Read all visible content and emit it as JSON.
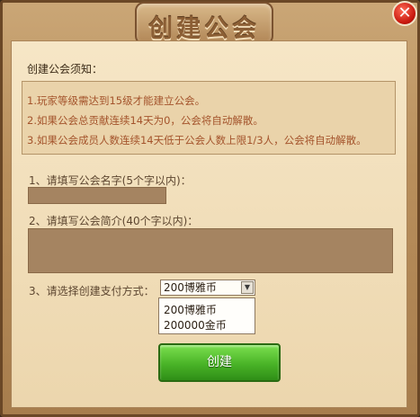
{
  "window": {
    "title": "创建公会",
    "close_symbol": "✕"
  },
  "notice": {
    "title": "创建公会须知：",
    "lines": [
      "1.玩家等级需达到15级才能建立公会。",
      "2.如果公会总贡献连续14天为0，公会将自动解散。",
      "3.如果公会成员人数连续14天低于公会人数上限1/3人，公会将自动解散。"
    ]
  },
  "form": {
    "name_label": "1、请填写公会名字(5个字以内)：",
    "name_value": "",
    "intro_label": "2、请填写公会简介(40个字以内)：",
    "intro_value": "",
    "payment_label": "3、请选择创建支付方式：",
    "payment_selected": "200博雅币",
    "payment_options": [
      "200博雅币",
      "200000金币"
    ]
  },
  "buttons": {
    "create": "创建"
  },
  "colors": {
    "frame": "#b98f5c",
    "panel": "#f2e0bd",
    "notice_text": "#a4542c",
    "create_button": "#49b327",
    "close_button": "#c8180e"
  }
}
